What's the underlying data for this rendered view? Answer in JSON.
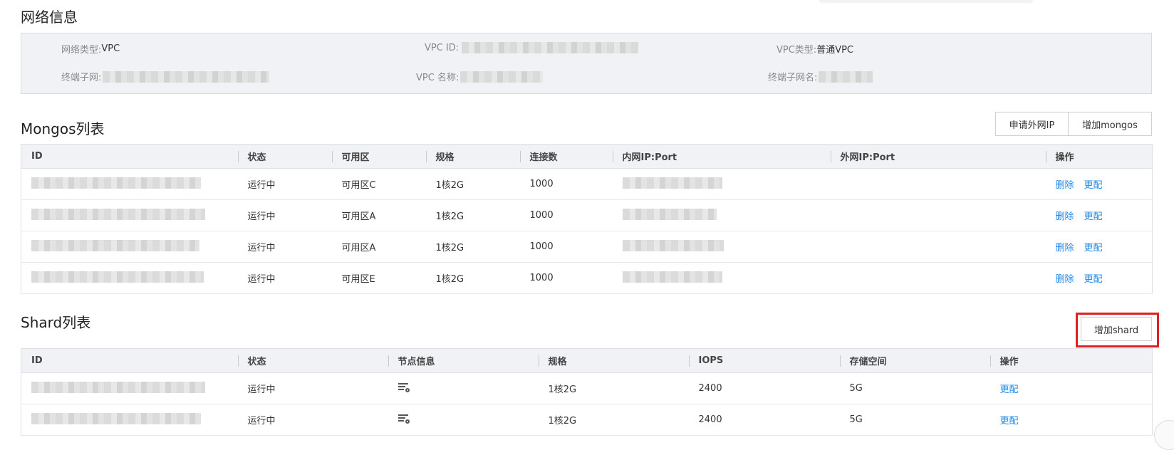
{
  "network": {
    "title": "网络信息",
    "network_type_label": "网络类型:",
    "network_type_value": "VPC",
    "vpc_id_label": "VPC ID:",
    "vpc_type_label": "VPC类型:",
    "vpc_type_value": "普通VPC",
    "terminal_subnet_label": "终端子网:",
    "vpc_name_label": "VPC 名称:",
    "terminal_subnet_name_label": "终端子网名:"
  },
  "mongos": {
    "title": "Mongos列表",
    "apply_ip_button": "申请外网IP",
    "add_mongos_button": "增加mongos",
    "columns": [
      "ID",
      "状态",
      "可用区",
      "规格",
      "连接数",
      "内网IP:Port",
      "外网IP:Port",
      "操作"
    ],
    "rows": [
      {
        "status": "运行中",
        "zone": "可用区C",
        "spec": "1核2G",
        "connections": "1000",
        "action_delete": "删除",
        "action_modify": "更配"
      },
      {
        "status": "运行中",
        "zone": "可用区A",
        "spec": "1核2G",
        "connections": "1000",
        "action_delete": "删除",
        "action_modify": "更配"
      },
      {
        "status": "运行中",
        "zone": "可用区A",
        "spec": "1核2G",
        "connections": "1000",
        "action_delete": "删除",
        "action_modify": "更配"
      },
      {
        "status": "运行中",
        "zone": "可用区E",
        "spec": "1核2G",
        "connections": "1000",
        "action_delete": "删除",
        "action_modify": "更配"
      }
    ]
  },
  "shard": {
    "title": "Shard列表",
    "add_shard_button": "增加shard",
    "columns": [
      "ID",
      "状态",
      "节点信息",
      "规格",
      "IOPS",
      "存储空间",
      "操作"
    ],
    "rows": [
      {
        "status": "运行中",
        "spec": "1核2G",
        "iops": "2400",
        "storage": "5G",
        "action_modify": "更配"
      },
      {
        "status": "运行中",
        "spec": "1核2G",
        "iops": "2400",
        "storage": "5G",
        "action_modify": "更配"
      }
    ]
  },
  "colors": {
    "running": "#0b9e3c",
    "link": "#1e88e5",
    "highlight": "#e02020"
  },
  "icons": {
    "node_info": "list-search-icon"
  }
}
